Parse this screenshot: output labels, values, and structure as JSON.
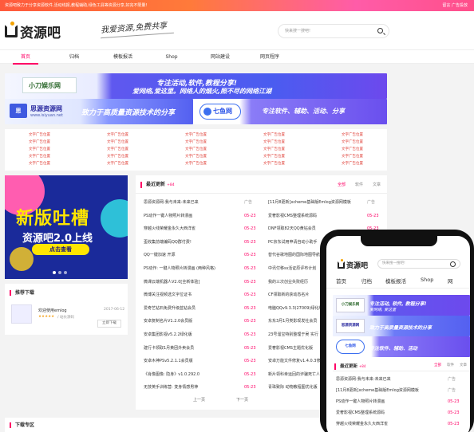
{
  "topbar": {
    "notice": "资源吧致力于分享资源软件,活动线报,教程辅助,绿色工具等资源分享,好完不限量!",
    "links": "留言    广告投放"
  },
  "logo": {
    "text": "资源吧"
  },
  "slogan": "我爱资源,免费共享",
  "search": {
    "placeholder": "快来搜一搜吧!"
  },
  "nav": [
    "首页",
    "归档",
    "模板报活",
    "Shop",
    "网站建设",
    "网页程序"
  ],
  "banners": {
    "b1": {
      "logo": "小刀娱乐网",
      "line1": "专注活动,软件,教程分享!",
      "line2": "爱网络,爱这里。网络人的烟火,照不尽的网络江湖"
    },
    "b2": {
      "logo": "思",
      "name": "思源资源网",
      "sub": "www.isiyuan.net",
      "line": "致力于高质量资源技术的分享"
    },
    "b3": {
      "logo": "七鱼网",
      "line": "专注软件、辅助、活动、分享"
    }
  },
  "ads": [
    "文字广告位置",
    "文字广告位置",
    "文字广告位置",
    "文字广告位置",
    "文字广告位置",
    "文字广告位置",
    "文字广告位置",
    "文字广告位置",
    "文字广告位置",
    "文字广告位置",
    "文字广告位置",
    "文字广告位置",
    "文字广告位置",
    "文字广告位置",
    "文字广告位置",
    "文字广告位置",
    "文字广告位置",
    "文字广告位置",
    "文字广告位置",
    "文字广告位置",
    "文字广告位置",
    "文字广告位置",
    "文字广告位置",
    "文字广告位置",
    "文字广告位置"
  ],
  "promo": {
    "title": "新版吐槽",
    "subtitle": "资源吧2.0上线",
    "button": "点击查看"
  },
  "recommend": {
    "title": "推荐下载",
    "name": "欢迎使用emlog",
    "date": "2017-06-12",
    "stars": "★★★★★",
    "cat": "/ 站长源码",
    "button": "立即下载"
  },
  "news": {
    "title": "最近更新",
    "badge": "+84",
    "tabs": [
      "全部",
      "软件",
      "文章"
    ],
    "left": [
      {
        "t": "思源资源网-我与未来-未来已来",
        "d": "广告"
      },
      {
        "t": "PS动作一键人物照片转漫画",
        "d": "05-23"
      },
      {
        "t": "穿越火线荣耀金永久大西洋雀",
        "d": "05-23"
      },
      {
        "t": "歪收集前端编码QQ群付费!",
        "d": "05-23"
      },
      {
        "t": "QQ一键加速 开源",
        "d": "05-23"
      },
      {
        "t": "PS动作: 一键人物照片转漫画 (两种风格)",
        "d": "05-23"
      },
      {
        "t": "微课云端机器人V2.0[全新体验]",
        "d": "05-23"
      },
      {
        "t": "微博关注视频选文字位证书",
        "d": "05-23"
      },
      {
        "t": "爱奇艺钻石免费升级蓝钻会员",
        "d": "05-23"
      },
      {
        "t": "安卓复制名片V1.2.0会员版",
        "d": "05-23"
      },
      {
        "t": "安卓集团影视v5.2.2绿化版",
        "d": "05-23"
      },
      {
        "t": "建行卡领取1月黄团外卖会员",
        "d": "05-23"
      },
      {
        "t": "安卓木神PSv5.2.1.1会员版",
        "d": "05-23"
      },
      {
        "t": "《肖像图像: 隐身》v1.0.292.0",
        "d": "05-23"
      },
      {
        "t": "无技英手训练营: 变身情感男神",
        "d": "05-23"
      }
    ],
    "right": [
      {
        "t": "[11月8更新]xcheme基础版Emlog资源网模板",
        "d": "广告"
      },
      {
        "t": "爱奢影视CMS整理系统源码",
        "d": "05-23"
      },
      {
        "t": "DNF领取82天QQ黄钻会员",
        "d": "05-23"
      },
      {
        "t": "PC京东试用申请自动小助手",
        "d": "05-23"
      },
      {
        "t": "替代谷歌地图的国际地图导航",
        "d": "05-23"
      },
      {
        "t": "中讯付移ss活证原评布计划",
        "d": "05-23"
      },
      {
        "t": "我的三次创业失败经历",
        "d": "05-23"
      },
      {
        "t": "CF领取新的获动态名片",
        "d": "05-23"
      },
      {
        "t": "电脑QQv9.3.3(27009)绿化版",
        "d": "05-23"
      },
      {
        "t": "东东3月1月类影现发社会员",
        "d": "05-23"
      },
      {
        "t": "23号溜宝特别整理于吴 实行",
        "d": "05-23"
      },
      {
        "t": "爱奢影视CMS主题优化版",
        "d": "05-23"
      },
      {
        "t": "安卓万能文件修复v1.4.0.3修改版",
        "d": "05-23"
      },
      {
        "t": "新片领科幸运回的诈骗死亡人",
        "d": "05-23"
      },
      {
        "t": "青珠致际 动物教程图优化版",
        "d": "05-23"
      }
    ],
    "pager": {
      "prev": "上一页",
      "next": "下一页"
    }
  },
  "download_zone": {
    "title": "下载专区"
  },
  "phone": {
    "logo": "资源吧",
    "search": "快来搜一搜吧!",
    "nav": [
      "首页",
      "归档",
      "模板报活",
      "Shop",
      "网"
    ],
    "b1": {
      "logo": "小刀娱乐网",
      "t1": "专注活动, 软件, 教程分享!",
      "t2": "爱网络, 爱这里"
    },
    "b2": {
      "logo": "思源资源网",
      "t1": "致力于高质量资源技术的分享"
    },
    "b3": {
      "logo": "七鱼网",
      "t1": "专注软件、辅助、活动"
    },
    "news": {
      "title": "最近更新",
      "badge": "+84",
      "tabs": [
        "全部",
        "软件",
        "文章"
      ],
      "rows": [
        {
          "t": "思源资源网-我与未来-未来已来",
          "d": "广告"
        },
        {
          "t": "[11月8更新]xcheme基础版Emlog资源网模板",
          "d": "广告"
        },
        {
          "t": "PS动作一键人物照片转漫画",
          "d": "05-23"
        },
        {
          "t": "爱奢影视CMS整理系统源码",
          "d": "05-23"
        },
        {
          "t": "穿越火线荣耀金永久大西洋雀",
          "d": "05-23"
        }
      ]
    }
  }
}
